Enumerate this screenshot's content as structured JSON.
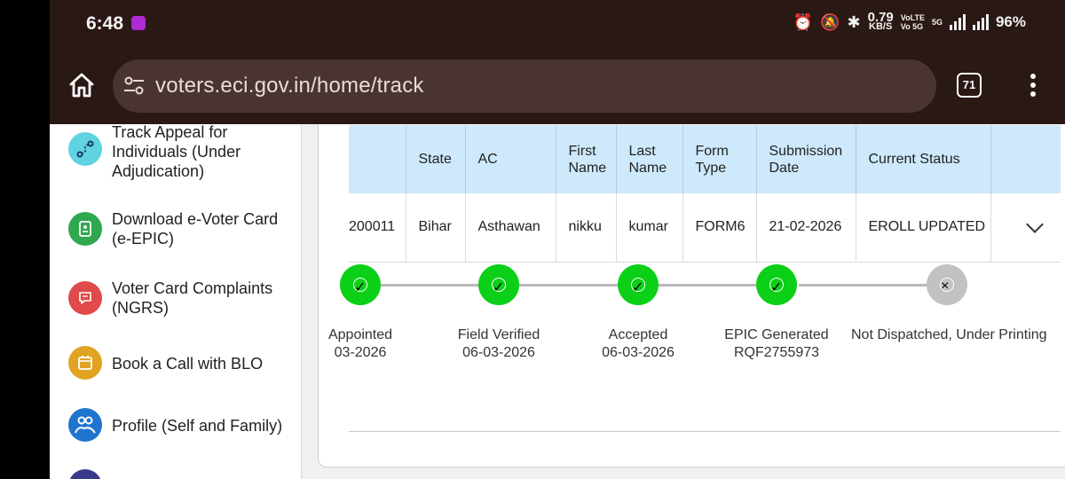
{
  "status_bar": {
    "time": "6:48",
    "speed_value": "0.79",
    "speed_unit": "KB/S",
    "volte_top": "VoLTE",
    "volte_bottom": "Vo 5G",
    "network": "5G",
    "battery": "96%"
  },
  "browser": {
    "url": "voters.eci.gov.in/home/track",
    "tab_count": "71"
  },
  "sidebar": {
    "items": [
      {
        "label": "Track Appeal for Individuals (Under Adjudication)",
        "icon": "route-icon",
        "color": "#5fd3e0"
      },
      {
        "label": "Download e-Voter Card (e-EPIC)",
        "icon": "id-card-icon",
        "color": "#2fa84f"
      },
      {
        "label": "Voter Card Complaints (NGRS)",
        "icon": "complaint-icon",
        "color": "#e04a4a"
      },
      {
        "label": "Book a Call with BLO",
        "icon": "calendar-icon",
        "color": "#e0a422"
      },
      {
        "label": "Profile (Self and Family)",
        "icon": "family-icon",
        "color": "#1f74d0"
      }
    ]
  },
  "table": {
    "headers": [
      "",
      "State",
      "AC",
      "First Name",
      "Last Name",
      "Form Type",
      "Submission Date",
      "Current Status",
      ""
    ],
    "row": [
      "200011",
      "Bihar",
      "Asthawan",
      "nikku",
      "kumar",
      "FORM6",
      "21-02-2026",
      "EROLL UPDATED",
      ""
    ]
  },
  "timeline": {
    "steps": [
      {
        "title": "Appointed",
        "detail": "03-2026",
        "status": "done"
      },
      {
        "title": "Field Verified",
        "detail": "06-03-2026",
        "status": "done"
      },
      {
        "title": "Accepted",
        "detail": "06-03-2026",
        "status": "done"
      },
      {
        "title": "EPIC Generated",
        "detail": "RQF2755973",
        "status": "done"
      },
      {
        "title": "Not Dispatched, Under Printing",
        "detail": "",
        "status": "pending"
      }
    ]
  },
  "colors": {
    "chrome_bg": "#2a1815",
    "url_pill": "#4a3431",
    "header_bg": "#cde9fb",
    "step_done": "#0bd017",
    "step_pending": "#c2c2c2"
  }
}
